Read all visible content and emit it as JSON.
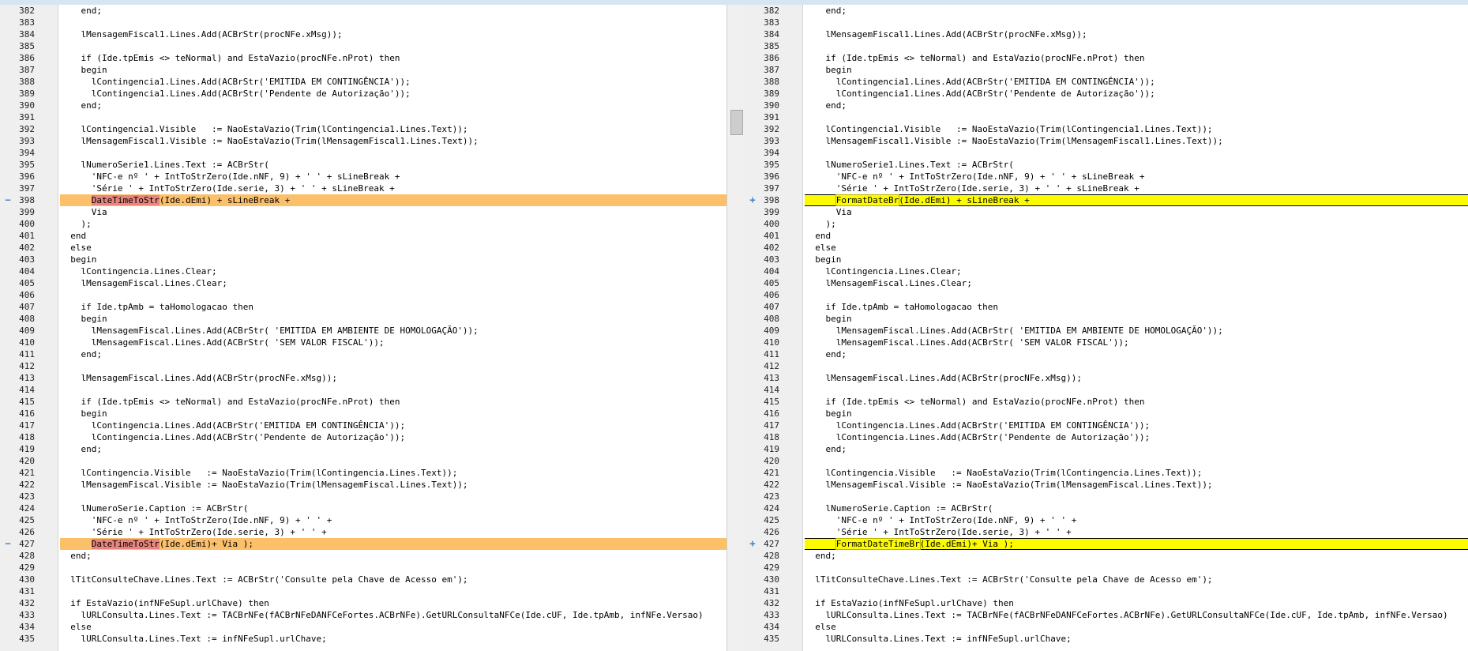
{
  "left": {
    "lines": [
      {
        "num": "382",
        "text": "    end;",
        "kind": "normal"
      },
      {
        "num": "383",
        "text": "",
        "kind": "normal"
      },
      {
        "num": "384",
        "text": "    lMensagemFiscal1.Lines.Add(ACBrStr(procNFe.xMsg));",
        "kind": "normal"
      },
      {
        "num": "385",
        "text": "",
        "kind": "normal"
      },
      {
        "num": "386",
        "text": "    if (Ide.tpEmis <> teNormal) and EstaVazio(procNFe.nProt) then",
        "kind": "normal"
      },
      {
        "num": "387",
        "text": "    begin",
        "kind": "normal"
      },
      {
        "num": "388",
        "text": "      lContingencia1.Lines.Add(ACBrStr('EMITIDA EM CONTINGÊNCIA'));",
        "kind": "normal"
      },
      {
        "num": "389",
        "text": "      lContingencia1.Lines.Add(ACBrStr('Pendente de Autorização'));",
        "kind": "normal"
      },
      {
        "num": "390",
        "text": "    end;",
        "kind": "normal"
      },
      {
        "num": "391",
        "text": "",
        "kind": "normal"
      },
      {
        "num": "392",
        "text": "    lContingencia1.Visible   := NaoEstaVazio(Trim(lContingencia1.Lines.Text));",
        "kind": "normal"
      },
      {
        "num": "393",
        "text": "    lMensagemFiscal1.Visible := NaoEstaVazio(Trim(lMensagemFiscal1.Lines.Text));",
        "kind": "normal"
      },
      {
        "num": "394",
        "text": "",
        "kind": "normal"
      },
      {
        "num": "395",
        "text": "    lNumeroSerie1.Lines.Text := ACBrStr(",
        "kind": "normal"
      },
      {
        "num": "396",
        "text": "      'NFC-e nº ' + IntToStrZero(Ide.nNF, 9) + ' ' + sLineBreak +",
        "kind": "normal"
      },
      {
        "num": "397",
        "text": "      'Série ' + IntToStrZero(Ide.serie, 3) + ' ' + sLineBreak +",
        "kind": "normal"
      },
      {
        "num": "398",
        "pre": "      ",
        "hl": "DateTimeToStr",
        "post": "(Ide.dEmi) + sLineBreak +",
        "kind": "removed",
        "marker": "−"
      },
      {
        "num": "399",
        "text": "      Via",
        "kind": "normal"
      },
      {
        "num": "400",
        "text": "    );",
        "kind": "normal"
      },
      {
        "num": "401",
        "text": "  end",
        "kind": "normal"
      },
      {
        "num": "402",
        "text": "  else",
        "kind": "normal"
      },
      {
        "num": "403",
        "text": "  begin",
        "kind": "normal"
      },
      {
        "num": "404",
        "text": "    lContingencia.Lines.Clear;",
        "kind": "normal"
      },
      {
        "num": "405",
        "text": "    lMensagemFiscal.Lines.Clear;",
        "kind": "normal"
      },
      {
        "num": "406",
        "text": "",
        "kind": "normal"
      },
      {
        "num": "407",
        "text": "    if Ide.tpAmb = taHomologacao then",
        "kind": "normal"
      },
      {
        "num": "408",
        "text": "    begin",
        "kind": "normal"
      },
      {
        "num": "409",
        "text": "      lMensagemFiscal.Lines.Add(ACBrStr( 'EMITIDA EM AMBIENTE DE HOMOLOGAÇÃO'));",
        "kind": "normal"
      },
      {
        "num": "410",
        "text": "      lMensagemFiscal.Lines.Add(ACBrStr( 'SEM VALOR FISCAL'));",
        "kind": "normal"
      },
      {
        "num": "411",
        "text": "    end;",
        "kind": "normal"
      },
      {
        "num": "412",
        "text": "",
        "kind": "normal"
      },
      {
        "num": "413",
        "text": "    lMensagemFiscal.Lines.Add(ACBrStr(procNFe.xMsg));",
        "kind": "normal"
      },
      {
        "num": "414",
        "text": "",
        "kind": "normal"
      },
      {
        "num": "415",
        "text": "    if (Ide.tpEmis <> teNormal) and EstaVazio(procNFe.nProt) then",
        "kind": "normal"
      },
      {
        "num": "416",
        "text": "    begin",
        "kind": "normal"
      },
      {
        "num": "417",
        "text": "      lContingencia.Lines.Add(ACBrStr('EMITIDA EM CONTINGÊNCIA'));",
        "kind": "normal"
      },
      {
        "num": "418",
        "text": "      lContingencia.Lines.Add(ACBrStr('Pendente de Autorização'));",
        "kind": "normal"
      },
      {
        "num": "419",
        "text": "    end;",
        "kind": "normal"
      },
      {
        "num": "420",
        "text": "",
        "kind": "normal"
      },
      {
        "num": "421",
        "text": "    lContingencia.Visible   := NaoEstaVazio(Trim(lContingencia.Lines.Text));",
        "kind": "normal"
      },
      {
        "num": "422",
        "text": "    lMensagemFiscal.Visible := NaoEstaVazio(Trim(lMensagemFiscal.Lines.Text));",
        "kind": "normal"
      },
      {
        "num": "423",
        "text": "",
        "kind": "normal"
      },
      {
        "num": "424",
        "text": "    lNumeroSerie.Caption := ACBrStr(",
        "kind": "normal"
      },
      {
        "num": "425",
        "text": "      'NFC-e nº ' + IntToStrZero(Ide.nNF, 9) + ' ' +",
        "kind": "normal"
      },
      {
        "num": "426",
        "text": "      'Série ' + IntToStrZero(Ide.serie, 3) + ' ' +",
        "kind": "normal"
      },
      {
        "num": "427",
        "pre": "      ",
        "hl": "DateTimeToStr",
        "post": "(Ide.dEmi)+ Via );",
        "kind": "removed",
        "marker": "−"
      },
      {
        "num": "428",
        "text": "  end;",
        "kind": "normal"
      },
      {
        "num": "429",
        "text": "",
        "kind": "normal"
      },
      {
        "num": "430",
        "text": "  lTitConsulteChave.Lines.Text := ACBrStr('Consulte pela Chave de Acesso em');",
        "kind": "normal"
      },
      {
        "num": "431",
        "text": "",
        "kind": "normal"
      },
      {
        "num": "432",
        "text": "  if EstaVazio(infNFeSupl.urlChave) then",
        "kind": "normal"
      },
      {
        "num": "433",
        "text": "    lURLConsulta.Lines.Text := TACBrNFe(fACBrNFeDANFCeFortes.ACBrNFe).GetURLConsultaNFCe(Ide.cUF, Ide.tpAmb, infNFe.Versao)",
        "kind": "normal"
      },
      {
        "num": "434",
        "text": "  else",
        "kind": "normal"
      },
      {
        "num": "435",
        "text": "    lURLConsulta.Lines.Text := infNFeSupl.urlChave;",
        "kind": "normal"
      }
    ]
  },
  "right": {
    "lines": [
      {
        "num": "382",
        "text": "    end;",
        "kind": "normal"
      },
      {
        "num": "383",
        "text": "",
        "kind": "normal"
      },
      {
        "num": "384",
        "text": "    lMensagemFiscal1.Lines.Add(ACBrStr(procNFe.xMsg));",
        "kind": "normal"
      },
      {
        "num": "385",
        "text": "",
        "kind": "normal"
      },
      {
        "num": "386",
        "text": "    if (Ide.tpEmis <> teNormal) and EstaVazio(procNFe.nProt) then",
        "kind": "normal"
      },
      {
        "num": "387",
        "text": "    begin",
        "kind": "normal"
      },
      {
        "num": "388",
        "text": "      lContingencia1.Lines.Add(ACBrStr('EMITIDA EM CONTINGÊNCIA'));",
        "kind": "normal"
      },
      {
        "num": "389",
        "text": "      lContingencia1.Lines.Add(ACBrStr('Pendente de Autorização'));",
        "kind": "normal"
      },
      {
        "num": "390",
        "text": "    end;",
        "kind": "normal"
      },
      {
        "num": "391",
        "text": "",
        "kind": "normal"
      },
      {
        "num": "392",
        "text": "    lContingencia1.Visible   := NaoEstaVazio(Trim(lContingencia1.Lines.Text));",
        "kind": "normal"
      },
      {
        "num": "393",
        "text": "    lMensagemFiscal1.Visible := NaoEstaVazio(Trim(lMensagemFiscal1.Lines.Text));",
        "kind": "normal"
      },
      {
        "num": "394",
        "text": "",
        "kind": "normal"
      },
      {
        "num": "395",
        "text": "    lNumeroSerie1.Lines.Text := ACBrStr(",
        "kind": "normal"
      },
      {
        "num": "396",
        "text": "      'NFC-e nº ' + IntToStrZero(Ide.nNF, 9) + ' ' + sLineBreak +",
        "kind": "normal"
      },
      {
        "num": "397",
        "text": "      'Série ' + IntToStrZero(Ide.serie, 3) + ' ' + sLineBreak +",
        "kind": "normal"
      },
      {
        "num": "398",
        "pre": "      ",
        "hl": "FormatDateBr",
        "post": "(Ide.dEmi) + sLineBreak +",
        "kind": "added",
        "marker": "+"
      },
      {
        "num": "399",
        "text": "      Via",
        "kind": "normal"
      },
      {
        "num": "400",
        "text": "    );",
        "kind": "normal"
      },
      {
        "num": "401",
        "text": "  end",
        "kind": "normal"
      },
      {
        "num": "402",
        "text": "  else",
        "kind": "normal"
      },
      {
        "num": "403",
        "text": "  begin",
        "kind": "normal"
      },
      {
        "num": "404",
        "text": "    lContingencia.Lines.Clear;",
        "kind": "normal"
      },
      {
        "num": "405",
        "text": "    lMensagemFiscal.Lines.Clear;",
        "kind": "normal"
      },
      {
        "num": "406",
        "text": "",
        "kind": "normal"
      },
      {
        "num": "407",
        "text": "    if Ide.tpAmb = taHomologacao then",
        "kind": "normal"
      },
      {
        "num": "408",
        "text": "    begin",
        "kind": "normal"
      },
      {
        "num": "409",
        "text": "      lMensagemFiscal.Lines.Add(ACBrStr( 'EMITIDA EM AMBIENTE DE HOMOLOGAÇÃO'));",
        "kind": "normal"
      },
      {
        "num": "410",
        "text": "      lMensagemFiscal.Lines.Add(ACBrStr( 'SEM VALOR FISCAL'));",
        "kind": "normal"
      },
      {
        "num": "411",
        "text": "    end;",
        "kind": "normal"
      },
      {
        "num": "412",
        "text": "",
        "kind": "normal"
      },
      {
        "num": "413",
        "text": "    lMensagemFiscal.Lines.Add(ACBrStr(procNFe.xMsg));",
        "kind": "normal"
      },
      {
        "num": "414",
        "text": "",
        "kind": "normal"
      },
      {
        "num": "415",
        "text": "    if (Ide.tpEmis <> teNormal) and EstaVazio(procNFe.nProt) then",
        "kind": "normal"
      },
      {
        "num": "416",
        "text": "    begin",
        "kind": "normal"
      },
      {
        "num": "417",
        "text": "      lContingencia.Lines.Add(ACBrStr('EMITIDA EM CONTINGÊNCIA'));",
        "kind": "normal"
      },
      {
        "num": "418",
        "text": "      lContingencia.Lines.Add(ACBrStr('Pendente de Autorização'));",
        "kind": "normal"
      },
      {
        "num": "419",
        "text": "    end;",
        "kind": "normal"
      },
      {
        "num": "420",
        "text": "",
        "kind": "normal"
      },
      {
        "num": "421",
        "text": "    lContingencia.Visible   := NaoEstaVazio(Trim(lContingencia.Lines.Text));",
        "kind": "normal"
      },
      {
        "num": "422",
        "text": "    lMensagemFiscal.Visible := NaoEstaVazio(Trim(lMensagemFiscal.Lines.Text));",
        "kind": "normal"
      },
      {
        "num": "423",
        "text": "",
        "kind": "normal"
      },
      {
        "num": "424",
        "text": "    lNumeroSerie.Caption := ACBrStr(",
        "kind": "normal"
      },
      {
        "num": "425",
        "text": "      'NFC-e nº ' + IntToStrZero(Ide.nNF, 9) + ' ' +",
        "kind": "normal"
      },
      {
        "num": "426",
        "text": "      'Série ' + IntToStrZero(Ide.serie, 3) + ' ' +",
        "kind": "normal"
      },
      {
        "num": "427",
        "pre": "      ",
        "hl": "FormatDateTimeBr",
        "post": "(Ide.dEmi)+ Via );",
        "kind": "added",
        "marker": "+"
      },
      {
        "num": "428",
        "text": "  end;",
        "kind": "normal"
      },
      {
        "num": "429",
        "text": "",
        "kind": "normal"
      },
      {
        "num": "430",
        "text": "  lTitConsulteChave.Lines.Text := ACBrStr('Consulte pela Chave de Acesso em');",
        "kind": "normal"
      },
      {
        "num": "431",
        "text": "",
        "kind": "normal"
      },
      {
        "num": "432",
        "text": "  if EstaVazio(infNFeSupl.urlChave) then",
        "kind": "normal"
      },
      {
        "num": "433",
        "text": "    lURLConsulta.Lines.Text := TACBrNFe(fACBrNFeDANFCeFortes.ACBrNFe).GetURLConsultaNFCe(Ide.cUF, Ide.tpAmb, infNFe.Versao)",
        "kind": "normal"
      },
      {
        "num": "434",
        "text": "  else",
        "kind": "normal"
      },
      {
        "num": "435",
        "text": "    lURLConsulta.Lines.Text := infNFeSupl.urlChave;",
        "kind": "normal"
      }
    ]
  },
  "colors": {
    "removed_line": "#fcc06b",
    "removed_token": "#e8847d",
    "added_line": "#fcfb00",
    "gutter": "#efefef"
  }
}
